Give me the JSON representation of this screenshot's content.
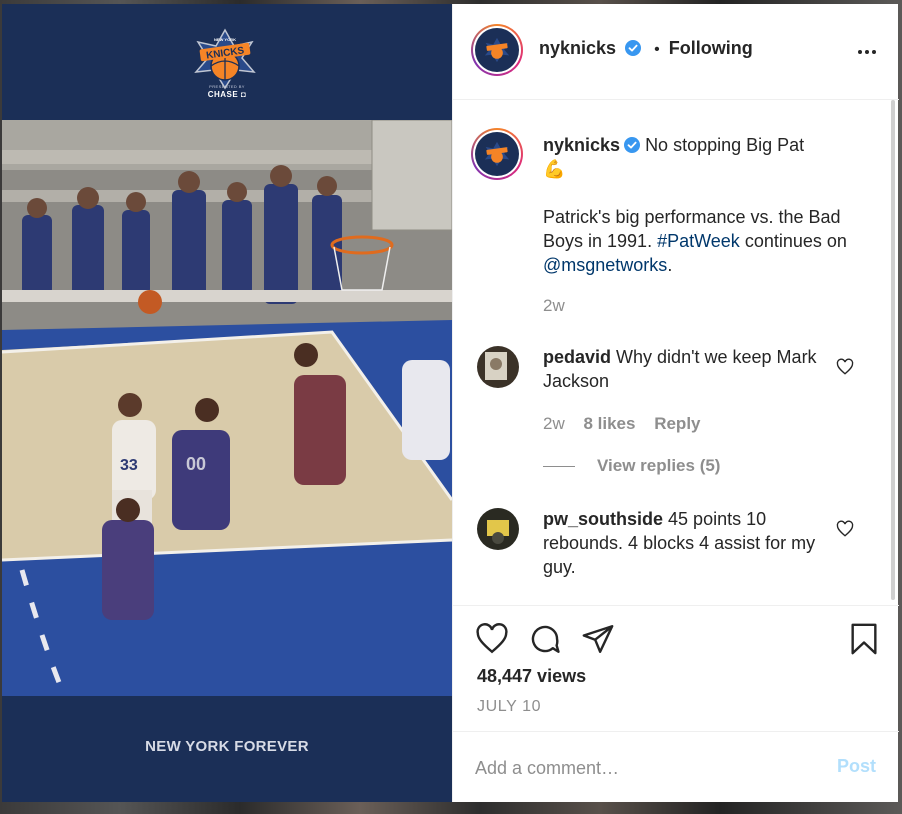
{
  "media": {
    "logo_text": "KNICKS",
    "logo_sub": "NEW YORK",
    "presented_by": "PRESENTED BY",
    "sponsor": "CHASE",
    "footer_text": "NEW YORK FOREVER"
  },
  "header": {
    "username": "nyknicks",
    "separator": "•",
    "follow_status": "Following"
  },
  "caption": {
    "username": "nyknicks",
    "line1": "No stopping Big Pat",
    "emoji": "💪",
    "body_part1": "Patrick's big performance vs. the Bad Boys in 1991.",
    "hashtag": "#PatWeek",
    "body_part2": "continues on",
    "mention": "@msgnetworks",
    "body_end": ".",
    "time": "2w"
  },
  "comments": [
    {
      "username": "pedavid",
      "text": "Why didn't we keep Mark Jackson",
      "time": "2w",
      "likes": "8 likes",
      "reply_label": "Reply",
      "view_replies": "View replies (5)"
    },
    {
      "username": "pw_southside",
      "text": "45 points 10 rebounds. 4 blocks 4 assist for my guy."
    }
  ],
  "stats": {
    "views": "48,447 views",
    "date": "JULY 10"
  },
  "add_comment": {
    "placeholder": "Add a comment…",
    "post_label": "Post"
  },
  "colors": {
    "knicks_blue": "#1b2f57",
    "knicks_orange": "#f58426",
    "verified_blue": "#3897f0",
    "link": "#00376b",
    "post_disabled": "#b2dffc"
  },
  "icons": [
    "knicks-logo-icon",
    "verified-badge-icon",
    "more-options-icon",
    "heart-icon",
    "comment-icon",
    "share-icon",
    "bookmark-icon"
  ]
}
